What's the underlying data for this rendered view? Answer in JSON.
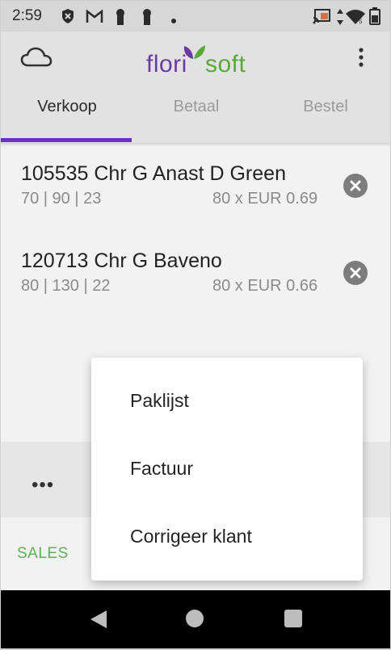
{
  "status_bar": {
    "time": "2:59",
    "icons": [
      "shield-x-icon",
      "gmail-icon",
      "keyhole-icon",
      "keyhole-icon",
      "dot-icon",
      "cast-icon",
      "data-arrows-icon",
      "wifi-icon",
      "battery-icon"
    ]
  },
  "app_bar": {
    "logo_part1": "flori",
    "logo_part2": "soft",
    "tabs": [
      {
        "label": "Verkoop",
        "active": true
      },
      {
        "label": "Betaal",
        "active": false
      },
      {
        "label": "Bestel",
        "active": false
      }
    ]
  },
  "items": [
    {
      "title": "105535 Chr G Anast D Green",
      "meta": "70 | 90 | 23",
      "price": "80 x EUR 0.69"
    },
    {
      "title": "120713 Chr G Baveno",
      "meta": "80 | 130 | 22",
      "price": "80 x EUR 0.66"
    }
  ],
  "footer": {
    "more": "•••",
    "sales": "SALES"
  },
  "menu": {
    "items": [
      "Paklijst",
      "Factuur",
      "Corrigeer klant"
    ]
  },
  "colors": {
    "brand_purple": "#6b3aa6",
    "brand_green": "#58a93a",
    "tab_indicator": "#6b2ec0",
    "sales_green": "#5bb259"
  }
}
